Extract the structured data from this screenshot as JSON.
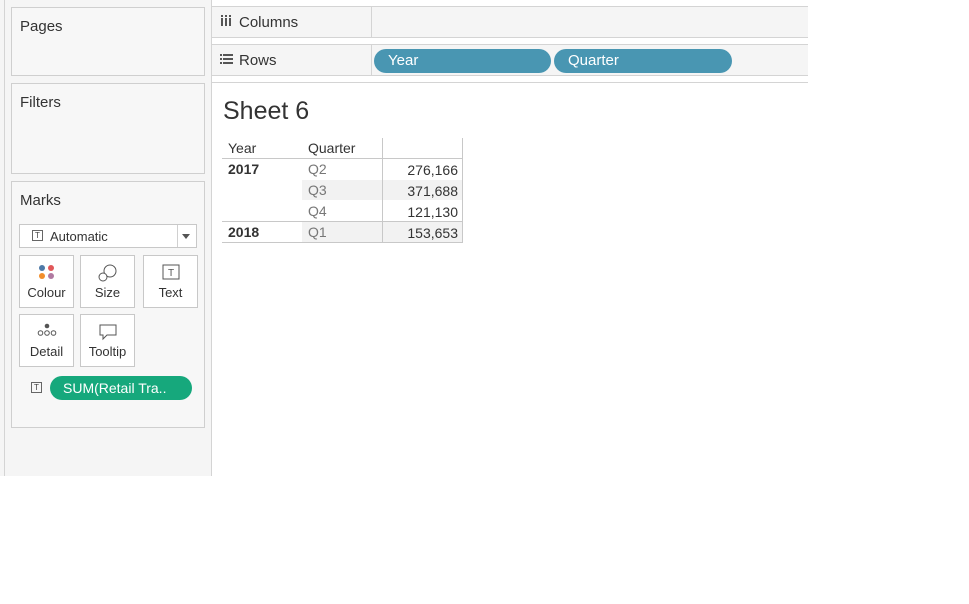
{
  "cards": {
    "pages": {
      "title": "Pages"
    },
    "filters": {
      "title": "Filters"
    },
    "marks": {
      "title": "Marks",
      "mark_type": "Automatic",
      "buttons": {
        "colour": "Colour",
        "size": "Size",
        "text": "Text",
        "detail": "Detail",
        "tooltip": "Tooltip"
      },
      "field_pill": "SUM(Retail Tra.."
    }
  },
  "shelves": {
    "columns": {
      "label": "Columns"
    },
    "rows": {
      "label": "Rows",
      "pills": [
        "Year",
        "Quarter"
      ]
    }
  },
  "sheet": {
    "title": "Sheet 6",
    "headers": {
      "year": "Year",
      "quarter": "Quarter"
    },
    "rows": [
      {
        "year": "2017",
        "quarter": "Q2",
        "value": "276,166"
      },
      {
        "year": "",
        "quarter": "Q3",
        "value": "371,688"
      },
      {
        "year": "",
        "quarter": "Q4",
        "value": "121,130"
      },
      {
        "year": "2018",
        "quarter": "Q1",
        "value": "153,653"
      }
    ]
  },
  "colors": {
    "dimension_pill": "#4996b2",
    "measure_pill": "#16a87c",
    "panel_background": "#f5f5f5"
  }
}
